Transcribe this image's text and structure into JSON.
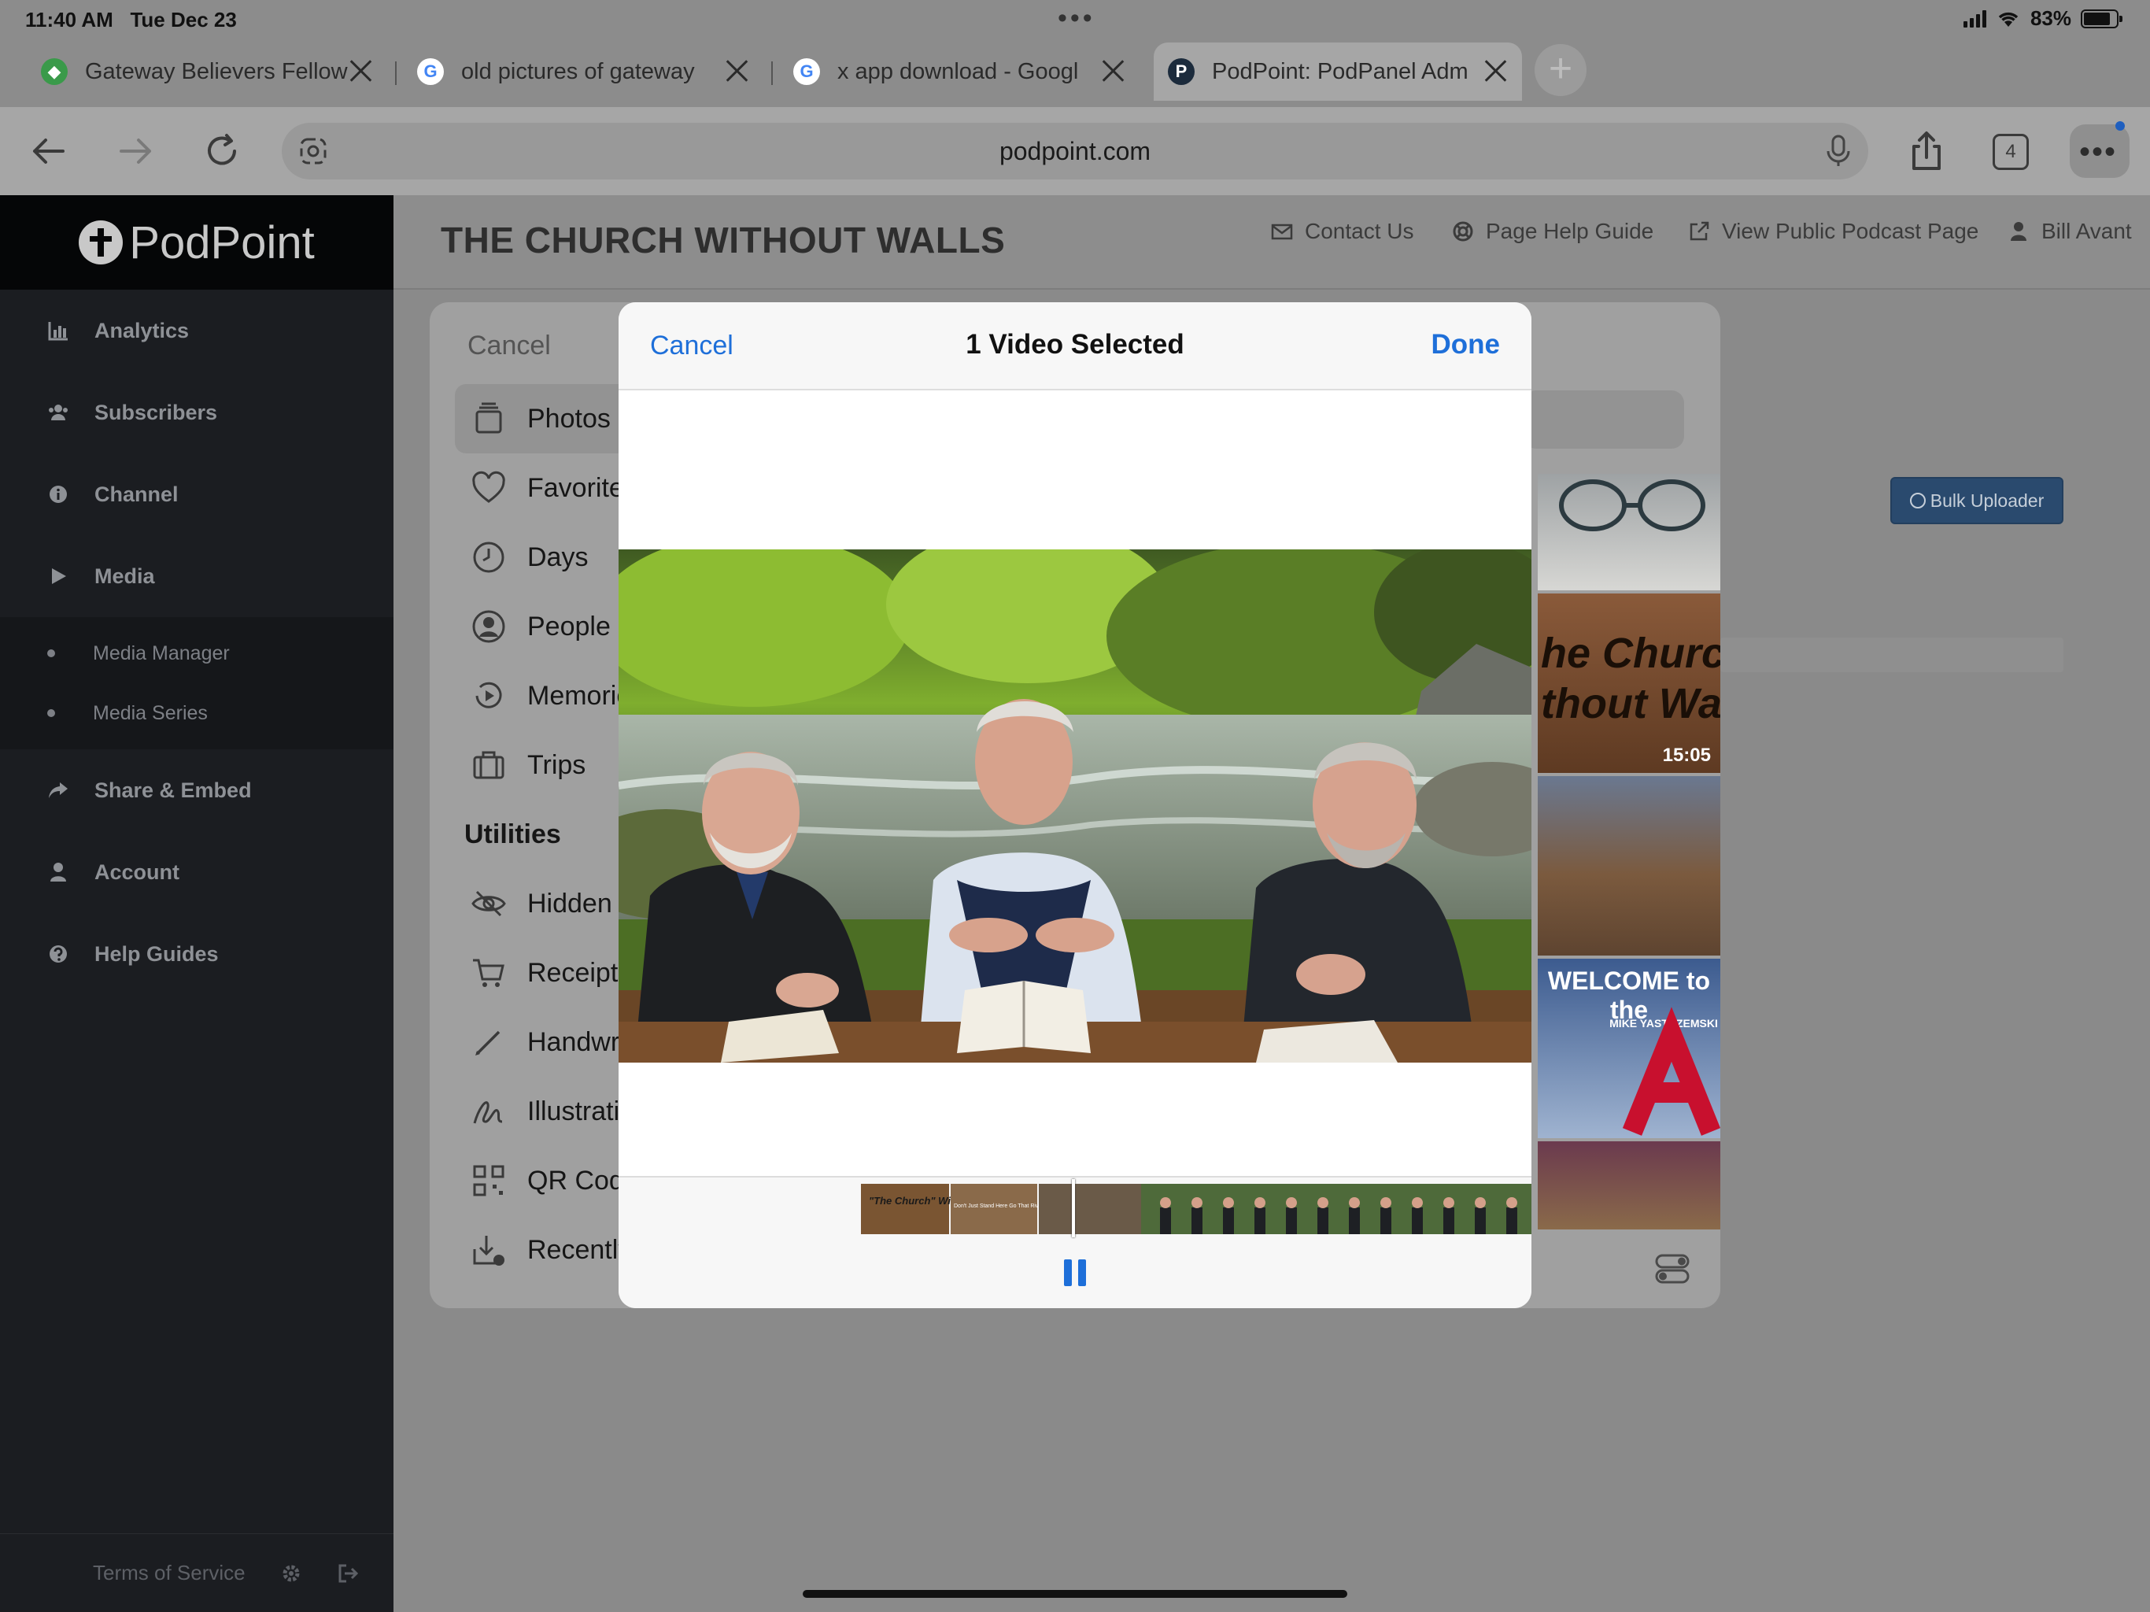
{
  "status_bar": {
    "time": "11:40 AM",
    "date": "Tue Dec 23",
    "battery": "83%",
    "battery_level": 0.83
  },
  "browser": {
    "tabs": [
      {
        "title": "Gateway Believers Fellow",
        "favicon": "leaf-icon"
      },
      {
        "title": "old pictures of gateway",
        "favicon": "google-icon"
      },
      {
        "title": "x app download - Googl",
        "favicon": "google-icon"
      },
      {
        "title": "PodPoint: PodPanel Adm",
        "favicon": "podpoint-icon",
        "active": true
      }
    ],
    "url": "podpoint.com",
    "tab_count": "4"
  },
  "sidebar": {
    "logo": "PodPoint",
    "items": [
      {
        "label": "Analytics",
        "icon": "bar-chart-icon"
      },
      {
        "label": "Subscribers",
        "icon": "users-icon"
      },
      {
        "label": "Channel",
        "icon": "info-icon"
      },
      {
        "label": "Media",
        "icon": "play-icon"
      }
    ],
    "subitems": [
      {
        "label": "Media Manager"
      },
      {
        "label": "Media Series"
      }
    ],
    "items_after": [
      {
        "label": "Share & Embed",
        "icon": "share-icon"
      },
      {
        "label": "Account",
        "icon": "user-icon"
      },
      {
        "label": "Help Guides",
        "icon": "help-icon"
      }
    ],
    "footer": {
      "terms": "Terms of Service"
    }
  },
  "header": {
    "title": "THE CHURCH WITHOUT WALLS",
    "links": [
      {
        "label": "Contact Us",
        "icon": "mail-icon"
      },
      {
        "label": "Page Help Guide",
        "icon": "lifebuoy-icon"
      },
      {
        "label": "View Public Podcast Page",
        "icon": "external-link-icon"
      },
      {
        "label": "Bill Avant",
        "icon": "user-icon"
      }
    ]
  },
  "page": {
    "bulk_uploader": "Bulk Uploader"
  },
  "picker": {
    "cancel": "Cancel",
    "albums": [
      {
        "label": "Photos",
        "icon": "photos-stack-icon",
        "selected": true
      },
      {
        "label": "Favorites",
        "icon": "heart-icon"
      },
      {
        "label": "Days",
        "icon": "clock-icon"
      },
      {
        "label": "People",
        "icon": "person-circle-icon"
      },
      {
        "label": "Memories",
        "icon": "memories-icon"
      },
      {
        "label": "Trips",
        "icon": "suitcase-icon"
      }
    ],
    "utilities_heading": "Utilities",
    "utilities": [
      {
        "label": "Hidden",
        "icon": "eye-slash-icon"
      },
      {
        "label": "Receipts",
        "icon": "cart-icon"
      },
      {
        "label": "Handwriting",
        "icon": "pencil-icon"
      },
      {
        "label": "Illustrations",
        "icon": "scribble-icon"
      },
      {
        "label": "QR Codes",
        "icon": "qr-code-icon"
      },
      {
        "label": "Recently",
        "icon": "tray-download-icon"
      }
    ],
    "thumbnails": [
      {
        "kind": "photo"
      },
      {
        "kind": "video",
        "text": "he Churc\nthout Wa",
        "duration": "15:05"
      },
      {
        "kind": "photo"
      },
      {
        "kind": "photo",
        "text": "WELCOME to the",
        "subtext": "MIKE YASTRZEMSKI"
      },
      {
        "kind": "photo"
      }
    ]
  },
  "modal": {
    "cancel": "Cancel",
    "title": "1 Video Selected",
    "done": "Done",
    "scrub_labels": [
      "\"The Church\" Without Walls",
      "Don't Just Stand Here Go That River Shore Come In The Water Answer His Call"
    ]
  },
  "colors": {
    "accent": "#1e6fd9",
    "sidebar_bg": "#1b1d21",
    "bulk_button": "#2a4a6e"
  }
}
